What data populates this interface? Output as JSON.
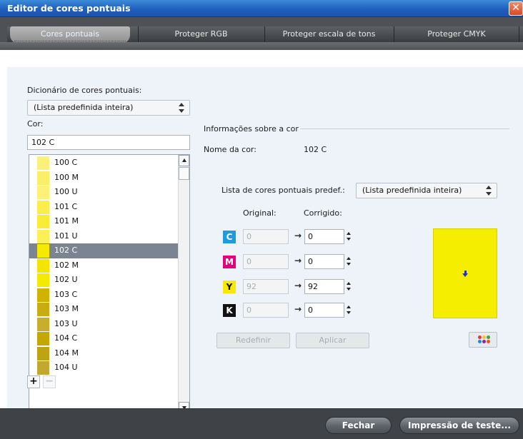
{
  "window": {
    "title": "Editor de cores pontuais",
    "close_glyph": "✕"
  },
  "tabs": [
    {
      "label": "Cores pontuais",
      "active": true
    },
    {
      "label": "Proteger RGB",
      "active": false
    },
    {
      "label": "Proteger escala de tons",
      "active": false
    },
    {
      "label": "Proteger CMYK",
      "active": false
    }
  ],
  "dictionary": {
    "label": "Dicionário de cores pontuais:",
    "selected": "(Lista predefinida inteira)"
  },
  "color_search": {
    "label": "Cor:",
    "value": "102 C"
  },
  "color_list": {
    "items": [
      {
        "name": "100 C",
        "swatch": "#fbf079"
      },
      {
        "name": "100 M",
        "swatch": "#fbef6a"
      },
      {
        "name": "100 U",
        "swatch": "#fdf178"
      },
      {
        "name": "101 C",
        "swatch": "#faee4b"
      },
      {
        "name": "101 M",
        "swatch": "#faec36"
      },
      {
        "name": "101 U",
        "swatch": "#fcf058"
      },
      {
        "name": "102 C",
        "swatch": "#f6e900",
        "selected": true
      },
      {
        "name": "102 M",
        "swatch": "#f4e500"
      },
      {
        "name": "102 U",
        "swatch": "#f6e900"
      },
      {
        "name": "103 C",
        "swatch": "#cfb300"
      },
      {
        "name": "103 M",
        "swatch": "#c9ad10"
      },
      {
        "name": "103 U",
        "swatch": "#c9ad2d"
      },
      {
        "name": "104 C",
        "swatch": "#c4a800"
      },
      {
        "name": "104 M",
        "swatch": "#c0a313"
      },
      {
        "name": "104 U",
        "swatch": "#c2a82e"
      }
    ]
  },
  "list_buttons": {
    "add": "+",
    "remove": "−"
  },
  "color_info": {
    "section_label": "Informações sobre a cor",
    "name_label": "Nome da cor:",
    "name_value": "102 C"
  },
  "predef_list": {
    "label": "Lista de cores pontuais predef.:",
    "selected": "(Lista predefinida inteira)"
  },
  "cmyk": {
    "original_header": "Original:",
    "corrected_header": "Corrigido:",
    "arrow": "→",
    "rows": [
      {
        "channel": "C",
        "color": "#1d9bdc",
        "text_color": "#ffffff",
        "original": "0",
        "corrected": "0"
      },
      {
        "channel": "M",
        "color": "#e5007d",
        "text_color": "#ffffff",
        "original": "0",
        "corrected": "0"
      },
      {
        "channel": "Y",
        "color": "#f7ea00",
        "text_color": "#111111",
        "original": "92",
        "corrected": "92"
      },
      {
        "channel": "K",
        "color": "#111111",
        "text_color": "#ffffff",
        "original": "0",
        "corrected": "0"
      }
    ]
  },
  "actions": {
    "reset": "Redefinir",
    "apply": "Aplicar"
  },
  "preview": {
    "color": "#f5ee00",
    "marker": "down-arrow-icon"
  },
  "palette_button": {
    "icon": "color-palette-icon"
  },
  "footer": {
    "close": "Fechar",
    "test_print": "Impressão de teste..."
  }
}
